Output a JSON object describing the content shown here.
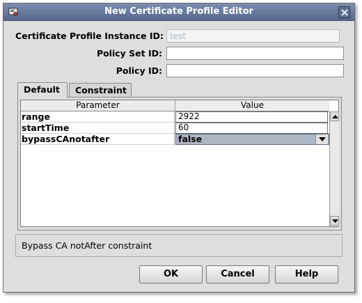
{
  "window": {
    "title": "New Certificate Profile Editor"
  },
  "form": {
    "instance_id_label": "Certificate Profile Instance ID:",
    "instance_id_value": "test",
    "policy_set_id_label": "Policy Set ID:",
    "policy_set_id_value": "",
    "policy_id_label": "Policy ID:",
    "policy_id_value": ""
  },
  "tabs": [
    {
      "label": "Default",
      "active": true
    },
    {
      "label": "Constraint",
      "active": false
    }
  ],
  "table": {
    "headers": [
      "Parameter",
      "Value"
    ],
    "rows": [
      {
        "parameter": "range",
        "value": "2922",
        "type": "text"
      },
      {
        "parameter": "startTime",
        "value": "60",
        "type": "text"
      },
      {
        "parameter": "bypassCAnotafter",
        "value": "false",
        "type": "select"
      }
    ]
  },
  "status_text": "Bypass CA notAfter constraint",
  "buttons": {
    "ok": "OK",
    "cancel": "Cancel",
    "help": "Help"
  },
  "icons": {
    "app": "certificate-icon",
    "close": "close-icon",
    "dropdown": "chevron-down-icon",
    "scroll_up": "arrow-up-icon",
    "scroll_down": "arrow-down-icon"
  },
  "colors": {
    "titlebar": "#5f7193",
    "selected_cell": "#aeb6c4",
    "window_bg": "#dedede"
  }
}
